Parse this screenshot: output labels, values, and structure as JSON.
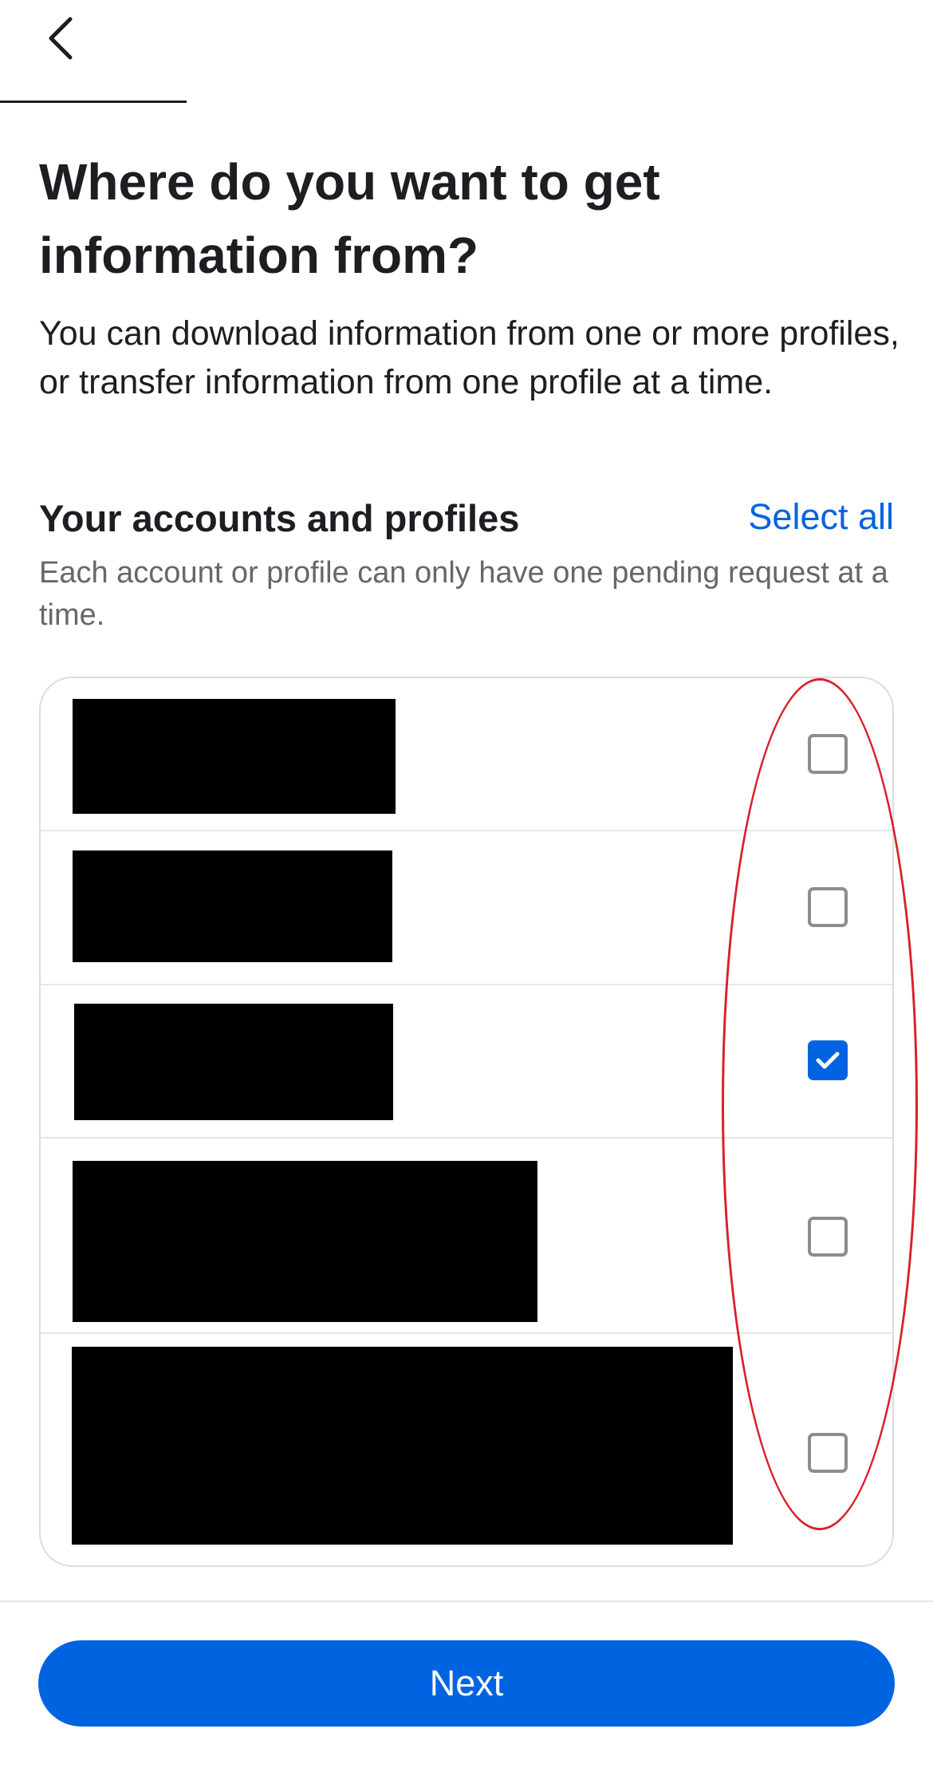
{
  "header": {
    "back_icon": "chevron-left-icon"
  },
  "page": {
    "title": "Where do you want to get information from?",
    "description": "You can download information from one or more profiles, or transfer information from one profile at a time."
  },
  "section": {
    "title": "Your accounts and profiles",
    "select_all_label": "Select all",
    "subtitle": "Each account or profile can only have one pending request at a time."
  },
  "accounts": [
    {
      "name": "[redacted]",
      "checked": false
    },
    {
      "name": "[redacted]",
      "checked": false
    },
    {
      "name": "[redacted]",
      "checked": true
    },
    {
      "name": "[redacted]",
      "checked": false
    },
    {
      "name": "[redacted]",
      "checked": false
    }
  ],
  "footer": {
    "next_label": "Next"
  },
  "colors": {
    "accent": "#0064e0",
    "highlight": "#d9202c",
    "text": "#1c1e21",
    "secondary_text": "#65676b"
  }
}
